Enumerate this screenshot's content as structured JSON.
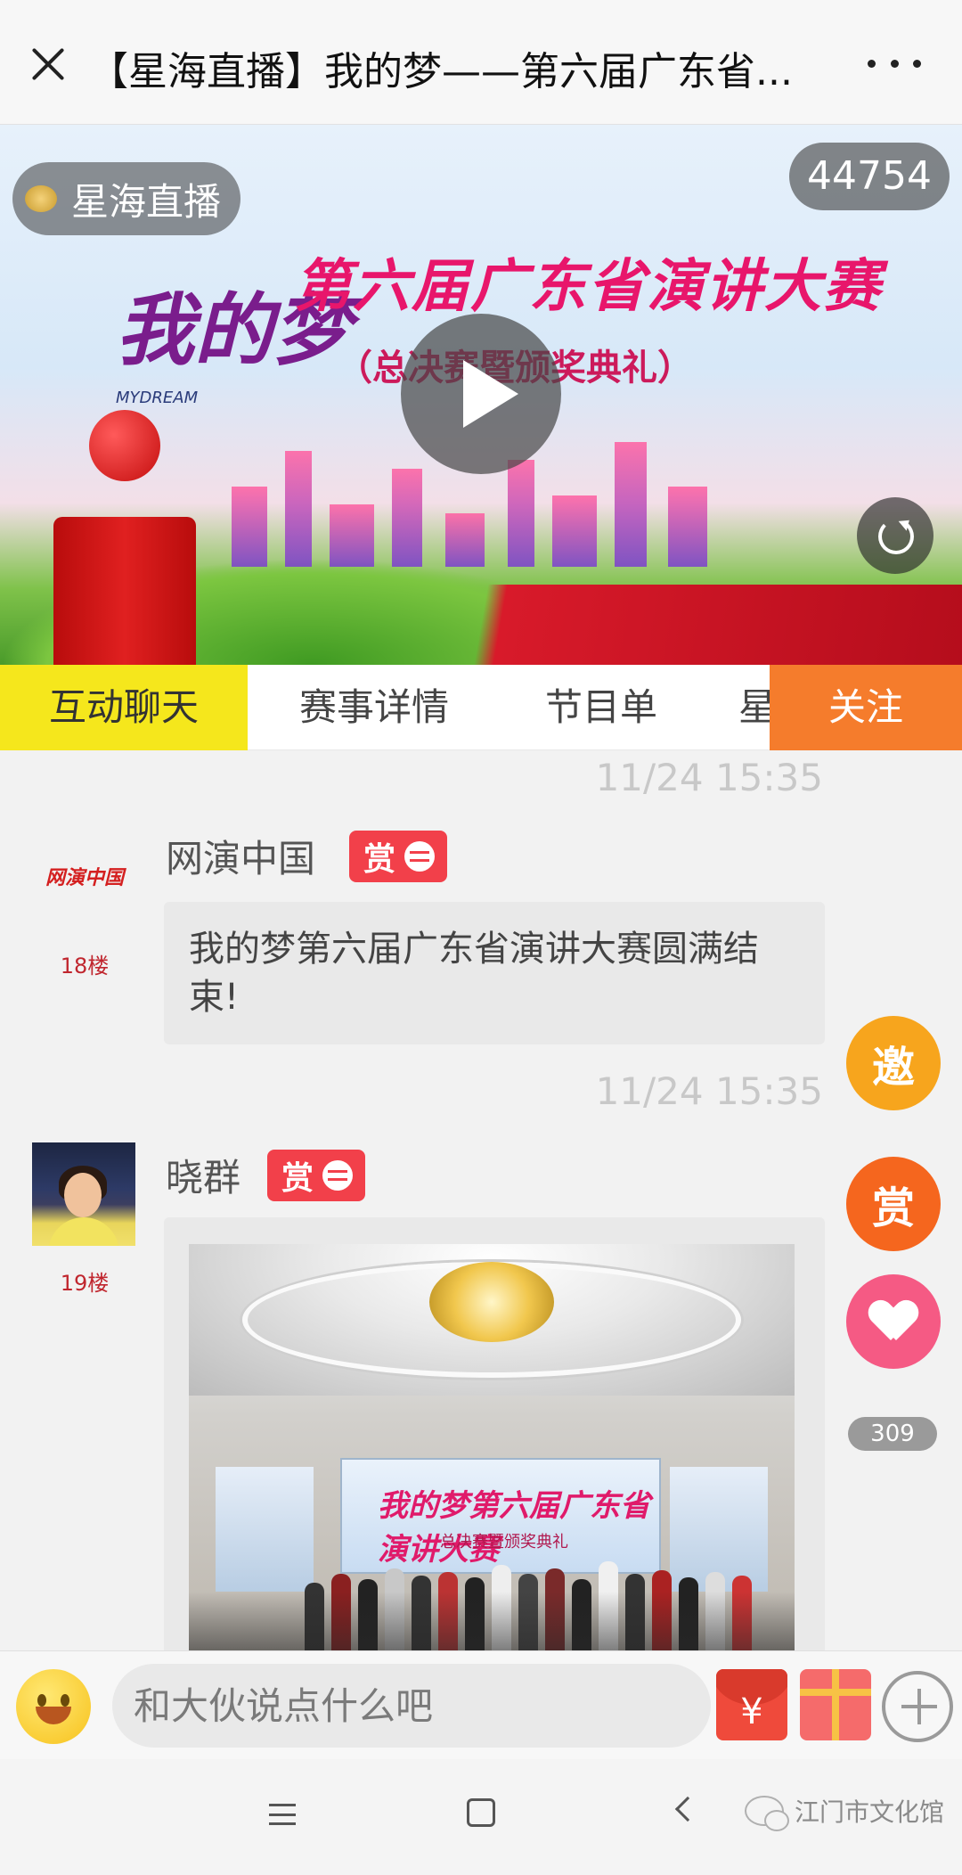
{
  "header": {
    "title": "【星海直播】我的梦——第六届广东省..."
  },
  "video": {
    "channel_name": "星海直播",
    "viewer_count": "44754",
    "banner_text": "我的梦",
    "banner_text_en": "MYDREAM",
    "banner_title": "第六届广东省演讲大赛",
    "banner_subtitle": "（总决赛暨颁奖典礼）"
  },
  "tabs": [
    {
      "label": "互动聊天",
      "active": true
    },
    {
      "label": "赛事详情",
      "active": false
    },
    {
      "label": "节目单",
      "active": false
    },
    {
      "label": "星",
      "active": false
    }
  ],
  "follow_label": "关注",
  "messages": [
    {
      "timestamp": "11/24 15:35",
      "user": "网演中国",
      "avatar_text": "网演中国",
      "floor": "18楼",
      "reward_label": "赏",
      "text": "我的梦第六届广东省演讲大赛圆满结束!"
    },
    {
      "timestamp": "11/24 15:35",
      "user": "晓群",
      "floor": "19楼",
      "reward_label": "赏",
      "image_text": "我的梦第六届广东省演讲大赛",
      "image_subtext": "总决赛暨颁奖典礼"
    }
  ],
  "floating": {
    "invite_label": "邀",
    "reward_label": "赏",
    "like_count": "309"
  },
  "input": {
    "placeholder": "和大伙说点什么吧",
    "redpacket_label": "¥"
  },
  "watermark": "江门市文化馆",
  "colors": {
    "tab_active": "#f5e71c",
    "follow": "#f57c2c",
    "reward_tag": "#f2404a",
    "invite": "#f7a51d",
    "reward_fab": "#f5661e",
    "like": "#f55a84"
  }
}
